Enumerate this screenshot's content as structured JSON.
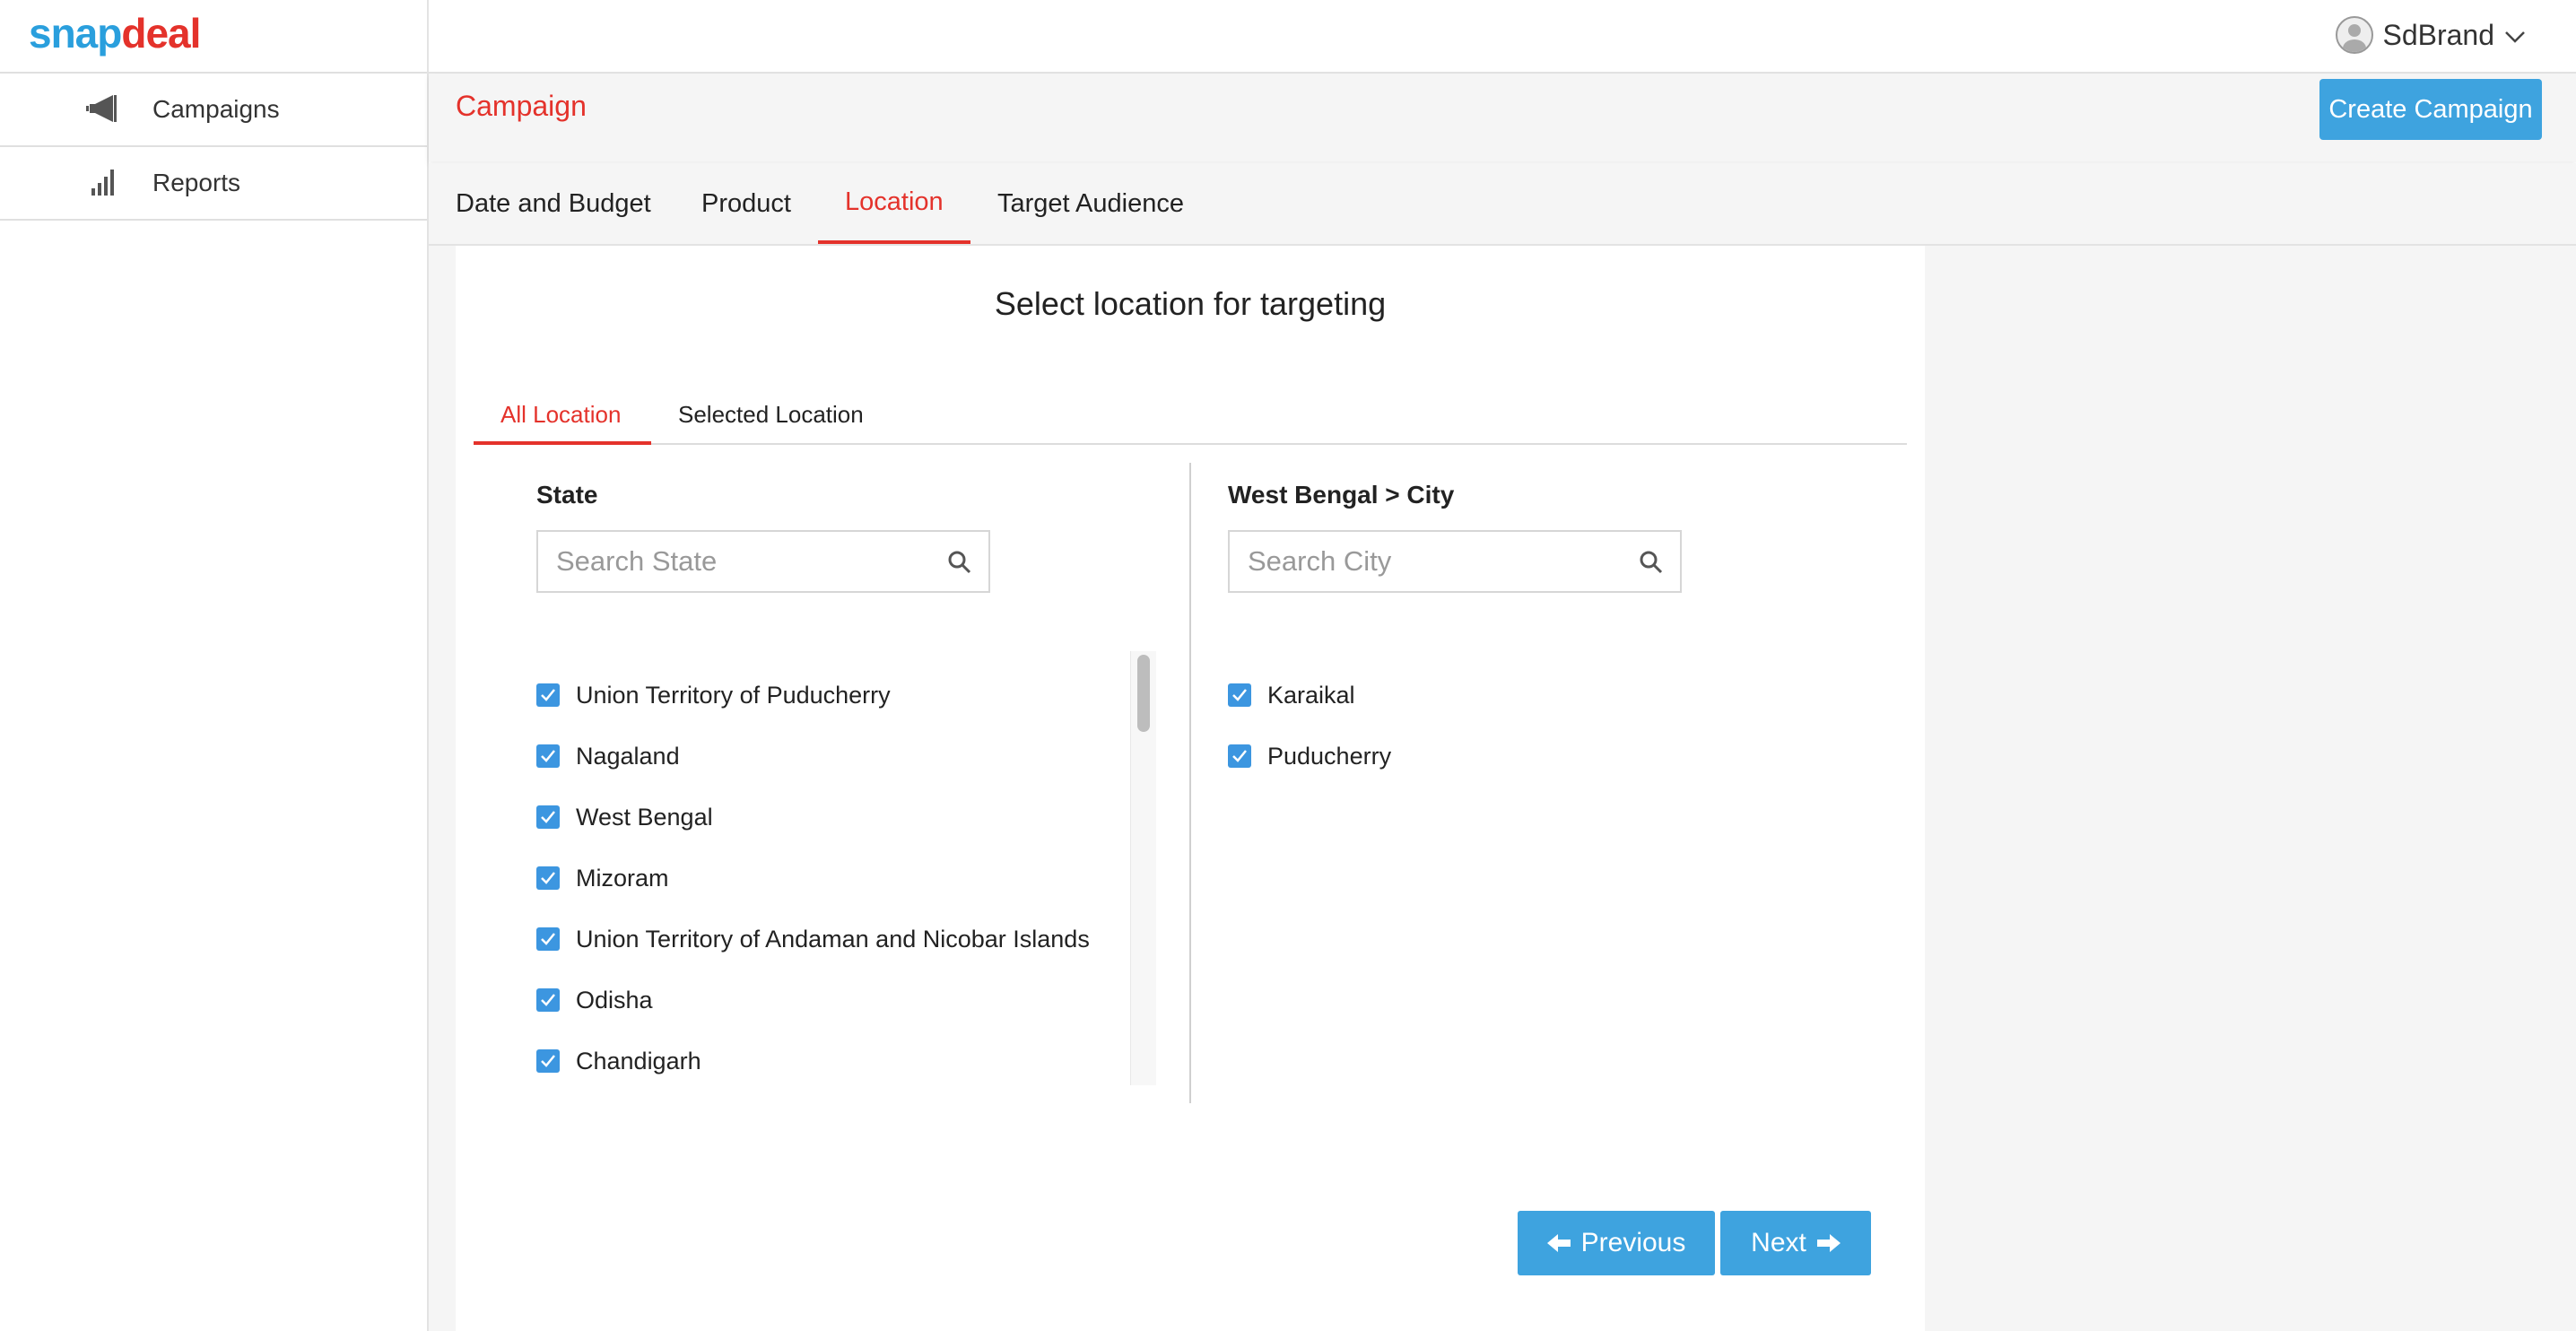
{
  "brand": {
    "logo_part1": "snap",
    "logo_part2": "deal"
  },
  "sidebar": {
    "items": [
      {
        "label": "Campaigns",
        "icon": "megaphone-icon"
      },
      {
        "label": "Reports",
        "icon": "bar-chart-icon"
      }
    ]
  },
  "header": {
    "user_name": "SdBrand"
  },
  "campaign": {
    "title": "Campaign",
    "create_button": "Create Campaign"
  },
  "steps": [
    {
      "label": "Date and Budget",
      "active": false
    },
    {
      "label": "Product",
      "active": false
    },
    {
      "label": "Location",
      "active": true
    },
    {
      "label": "Target Audience",
      "active": false
    }
  ],
  "location": {
    "title": "Select location for targeting",
    "tabs": [
      {
        "label": "All Location",
        "active": true
      },
      {
        "label": "Selected Location",
        "active": false
      }
    ],
    "state_column": {
      "heading": "State",
      "search_placeholder": "Search State",
      "items": [
        {
          "label": "Union Territory of Puducherry",
          "checked": true
        },
        {
          "label": "Nagaland",
          "checked": true
        },
        {
          "label": "West Bengal",
          "checked": true
        },
        {
          "label": "Mizoram",
          "checked": true
        },
        {
          "label": "Union Territory of Andaman and Nicobar Islands",
          "checked": true
        },
        {
          "label": "Odisha",
          "checked": true
        },
        {
          "label": "Chandigarh",
          "checked": true
        }
      ]
    },
    "city_column": {
      "heading": "West Bengal > City",
      "search_placeholder": "Search City",
      "items": [
        {
          "label": "Karaikal",
          "checked": true
        },
        {
          "label": "Puducherry",
          "checked": true
        }
      ]
    }
  },
  "navigation": {
    "previous": "Previous",
    "next": "Next"
  },
  "colors": {
    "accent_red": "#e4322b",
    "button_blue": "#3ea3df",
    "checkbox_blue": "#3c96e0"
  }
}
